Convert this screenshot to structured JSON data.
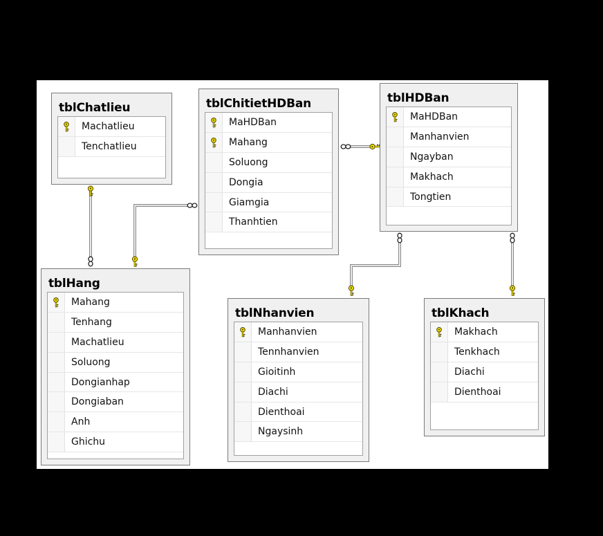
{
  "diagram": {
    "tables": [
      {
        "id": "tblChatlieu",
        "name": "tblChatlieu",
        "columns": [
          {
            "name": "Machatlieu",
            "pk": true
          },
          {
            "name": "Tenchatlieu",
            "pk": false
          }
        ]
      },
      {
        "id": "tblChitietHDBan",
        "name": "tblChitietHDBan",
        "columns": [
          {
            "name": "MaHDBan",
            "pk": true
          },
          {
            "name": "Mahang",
            "pk": true
          },
          {
            "name": "Soluong",
            "pk": false
          },
          {
            "name": "Dongia",
            "pk": false
          },
          {
            "name": "Giamgia",
            "pk": false
          },
          {
            "name": "Thanhtien",
            "pk": false
          }
        ]
      },
      {
        "id": "tblHDBan",
        "name": "tblHDBan",
        "columns": [
          {
            "name": "MaHDBan",
            "pk": true
          },
          {
            "name": "Manhanvien",
            "pk": false
          },
          {
            "name": "Ngayban",
            "pk": false
          },
          {
            "name": "Makhach",
            "pk": false
          },
          {
            "name": "Tongtien",
            "pk": false
          }
        ]
      },
      {
        "id": "tblHang",
        "name": "tblHang",
        "columns": [
          {
            "name": "Mahang",
            "pk": true
          },
          {
            "name": "Tenhang",
            "pk": false
          },
          {
            "name": "Machatlieu",
            "pk": false
          },
          {
            "name": "Soluong",
            "pk": false
          },
          {
            "name": "Dongianhap",
            "pk": false
          },
          {
            "name": "Dongiaban",
            "pk": false
          },
          {
            "name": "Anh",
            "pk": false
          },
          {
            "name": "Ghichu",
            "pk": false
          }
        ]
      },
      {
        "id": "tblNhanvien",
        "name": "tblNhanvien",
        "columns": [
          {
            "name": "Manhanvien",
            "pk": true
          },
          {
            "name": "Tennhanvien",
            "pk": false
          },
          {
            "name": "Gioitinh",
            "pk": false
          },
          {
            "name": "Diachi",
            "pk": false
          },
          {
            "name": "Dienthoai",
            "pk": false
          },
          {
            "name": "Ngaysinh",
            "pk": false
          }
        ]
      },
      {
        "id": "tblKhach",
        "name": "tblKhach",
        "columns": [
          {
            "name": "Makhach",
            "pk": true
          },
          {
            "name": "Tenkhach",
            "pk": false
          },
          {
            "name": "Diachi",
            "pk": false
          },
          {
            "name": "Dienthoai",
            "pk": false
          }
        ]
      }
    ],
    "relationships": [
      {
        "from": "tblChatlieu",
        "to": "tblHang"
      },
      {
        "from": "tblHang",
        "to": "tblChitietHDBan"
      },
      {
        "from": "tblHDBan",
        "to": "tblChitietHDBan"
      },
      {
        "from": "tblNhanvien",
        "to": "tblHDBan"
      },
      {
        "from": "tblKhach",
        "to": "tblHDBan"
      }
    ],
    "colors": {
      "key": "#f2e200",
      "key_stroke": "#4a4000",
      "line": "#8a8a8a",
      "table_bg": "#f0f0f0"
    }
  }
}
